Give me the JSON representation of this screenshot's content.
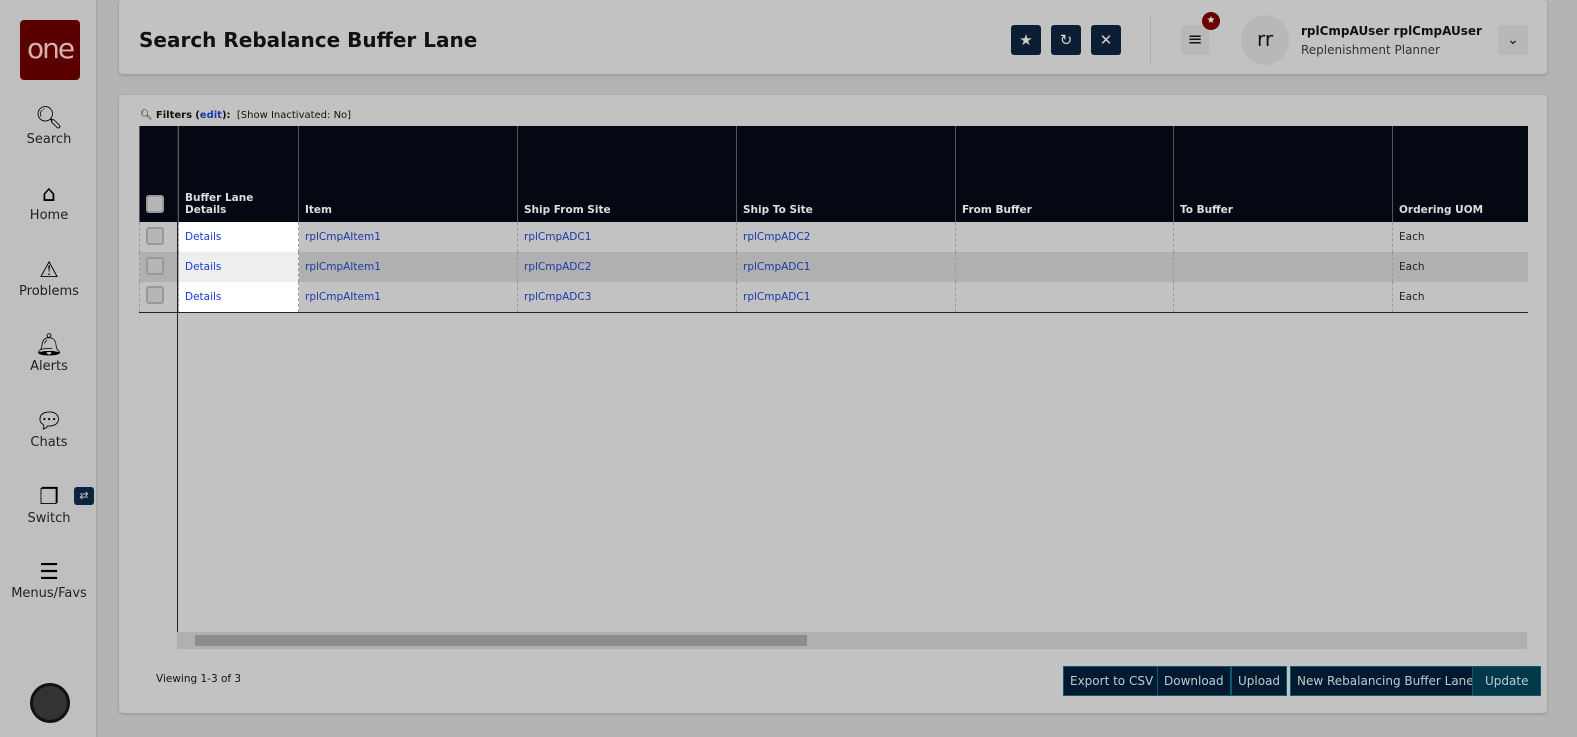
{
  "sidebar": {
    "logo": "one",
    "items": [
      {
        "label": "Search",
        "icon": "search-icon"
      },
      {
        "label": "Home",
        "icon": "home-icon"
      },
      {
        "label": "Problems",
        "icon": "warning-icon"
      },
      {
        "label": "Alerts",
        "icon": "bell-icon"
      },
      {
        "label": "Chats",
        "icon": "chat-icon"
      },
      {
        "label": "Switch",
        "icon": "switch-icon"
      },
      {
        "label": "Menus/Favs",
        "icon": "menu-icon"
      }
    ]
  },
  "header": {
    "title": "Search Rebalance Buffer Lane",
    "user_initials": "rr",
    "user_name": "rplCmpAUser rplCmpAUser",
    "user_role": "Replenishment Planner"
  },
  "filters": {
    "label": "Filters",
    "edit": "edit",
    "summary": "[Show Inactivated: No]"
  },
  "table": {
    "columns": [
      "Buffer Lane Details",
      "Item",
      "Ship From Site",
      "Ship To Site",
      "From Buffer",
      "To Buffer",
      "Ordering UOM"
    ],
    "rows": [
      {
        "details": "Details",
        "item": "rplCmpAItem1",
        "from_site": "rplCmpADC1",
        "to_site": "rplCmpADC2",
        "from_buffer": "",
        "to_buffer": "",
        "uom": "Each"
      },
      {
        "details": "Details",
        "item": "rplCmpAItem1",
        "from_site": "rplCmpADC2",
        "to_site": "rplCmpADC1",
        "from_buffer": "",
        "to_buffer": "",
        "uom": "Each"
      },
      {
        "details": "Details",
        "item": "rplCmpAItem1",
        "from_site": "rplCmpADC3",
        "to_site": "rplCmpADC1",
        "from_buffer": "",
        "to_buffer": "",
        "uom": "Each"
      }
    ]
  },
  "footer": {
    "viewing": "Viewing 1-3 of 3",
    "buttons": [
      "Export to CSV",
      "Download",
      "Upload",
      "New Rebalancing Buffer Lane",
      "Update"
    ]
  }
}
